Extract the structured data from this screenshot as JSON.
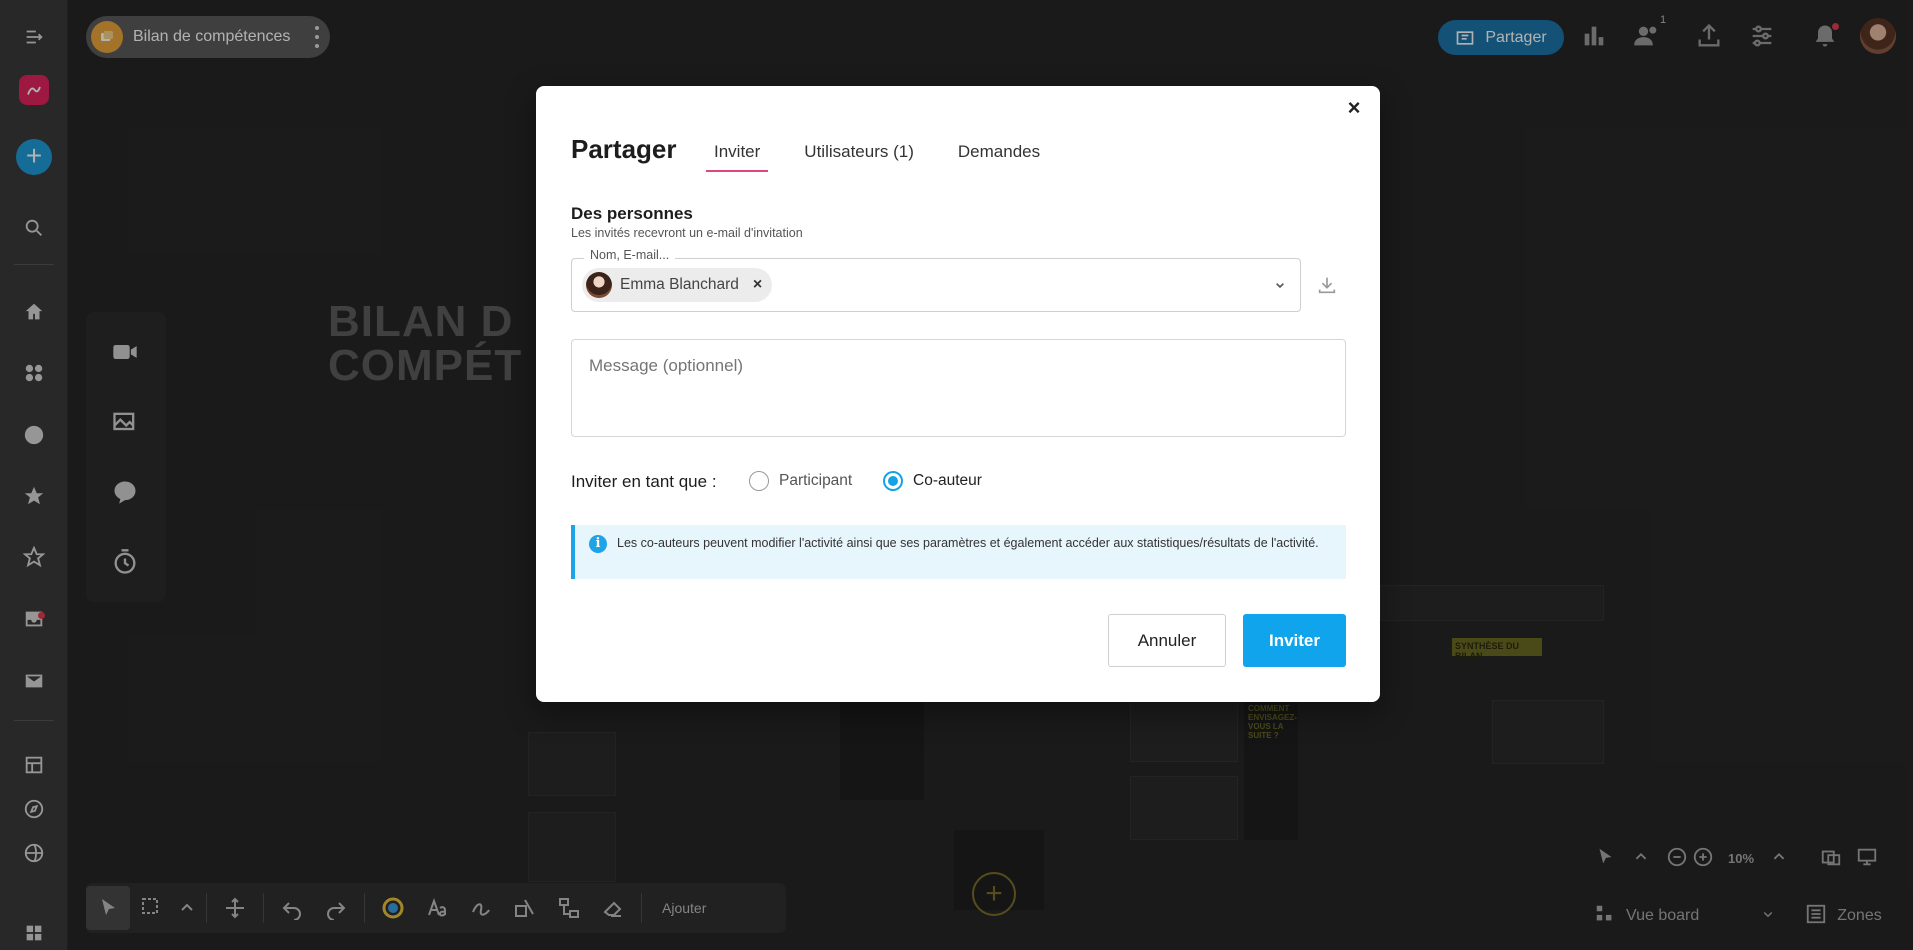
{
  "board": {
    "title": "Bilan de compétences",
    "share_label": "Partager",
    "participants_badge": "1",
    "deco_title_line1": "BILAN D",
    "deco_title_line2": "COMPÉT",
    "deco_synthese": "SYNTHÈSE DU BILAN",
    "deco_comment": "COMMENT ENVISAGEZ-VOUS LA SUITE ?"
  },
  "bottom_toolbar": {
    "add_label": "Ajouter",
    "zoom_value": "10%",
    "view_label": "Vue board",
    "zones_label": "Zones"
  },
  "modal": {
    "title": "Partager",
    "tabs": [
      {
        "label": "Inviter",
        "active": true
      },
      {
        "label": "Utilisateurs (1)",
        "active": false
      },
      {
        "label": "Demandes",
        "active": false
      }
    ],
    "section_title": "Des personnes",
    "section_subtitle": "Les invités recevront un e-mail d'invitation",
    "field_label": "Nom, E-mail...",
    "selected_user": "Emma Blanchard",
    "message_placeholder": "Message (optionnel)",
    "role_label": "Inviter en tant que :",
    "roles": [
      {
        "label": "Participant",
        "selected": false
      },
      {
        "label": "Co-auteur",
        "selected": true
      }
    ],
    "info_text": "Les co-auteurs peuvent modifier l'activité ainsi que ses paramètres et également accéder aux statistiques/résultats de l'activité.",
    "cancel_label": "Annuler",
    "invite_label": "Inviter"
  },
  "colors": {
    "accent": "#0fa4ec",
    "tab_underline": "#e0457f",
    "brand": "#e1245f"
  }
}
